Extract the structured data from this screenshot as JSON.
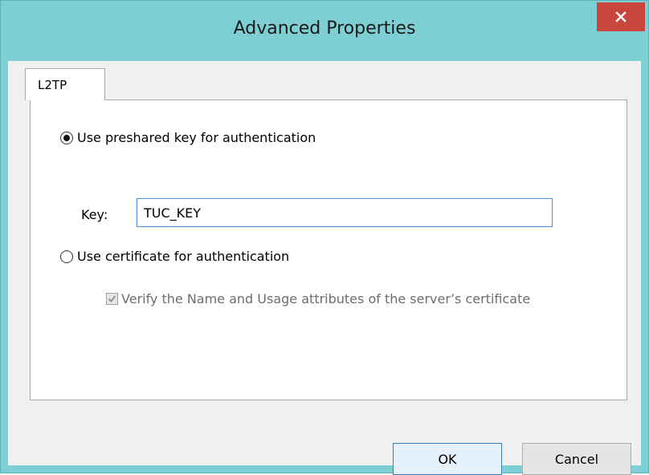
{
  "window": {
    "title": "Advanced Properties",
    "close_icon": "close-icon"
  },
  "tabs": [
    {
      "label": "L2TP",
      "selected": true
    }
  ],
  "options": {
    "preshared": {
      "label": "Use preshared key for authentication",
      "checked": true
    },
    "certificate": {
      "label": "Use certificate for authentication",
      "checked": false
    }
  },
  "key": {
    "label": "Key:",
    "value": "TUC_KEY"
  },
  "verify": {
    "label": "Verify the Name and Usage attributes of the server’s certificate",
    "checked": true,
    "enabled": false
  },
  "buttons": {
    "ok": "OK",
    "cancel": "Cancel"
  },
  "colors": {
    "frame": "#7ecfd3",
    "close": "#c9463d",
    "input_border": "#4a90d9"
  }
}
